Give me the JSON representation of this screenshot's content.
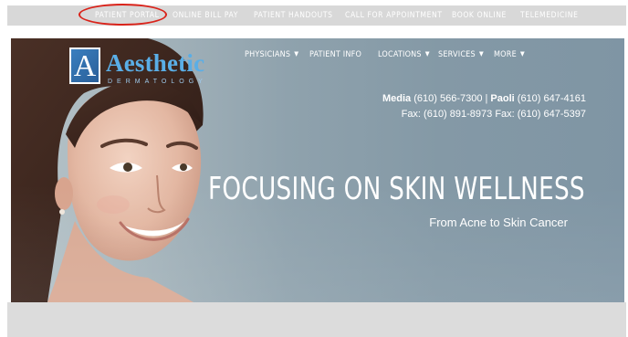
{
  "top_bar": {
    "links": [
      "PATIENT PORTAL",
      "ONLINE BILL PAY",
      "PATIENT HANDOUTS",
      "CALL FOR APPOINTMENT",
      "BOOK ONLINE",
      "TELEMEDICINE"
    ],
    "highlight_color": "#d9231a"
  },
  "logo": {
    "mark": "A",
    "name": "Aesthetic",
    "subtitle": "DERMATOLOGY"
  },
  "nav": {
    "items": [
      {
        "label": "PHYSICIANS",
        "has_dropdown": true
      },
      {
        "label": "PATIENT INFO",
        "has_dropdown": false
      },
      {
        "label": "LOCATIONS",
        "has_dropdown": true
      },
      {
        "label": "SERVICES",
        "has_dropdown": true
      },
      {
        "label": "MORE",
        "has_dropdown": true
      }
    ],
    "dropdown_glyph": "▼"
  },
  "contact": {
    "line1": {
      "loc1_name": "Media",
      "loc1_phone": " (610) 566-7300 | ",
      "loc2_name": "Paoli",
      "loc2_phone": " (610) 647-4161"
    },
    "line2": "Fax: (610) 891-8973 Fax: (610) 647-5397"
  },
  "hero": {
    "headline": "FOCUSING ON SKIN WELLNESS",
    "subheadline": "From Acne to Skin Cancer"
  },
  "colors": {
    "logo_blue": "#5aaee6",
    "hero_background": "#8fa2ad",
    "top_bar": "#d8d8d8"
  }
}
